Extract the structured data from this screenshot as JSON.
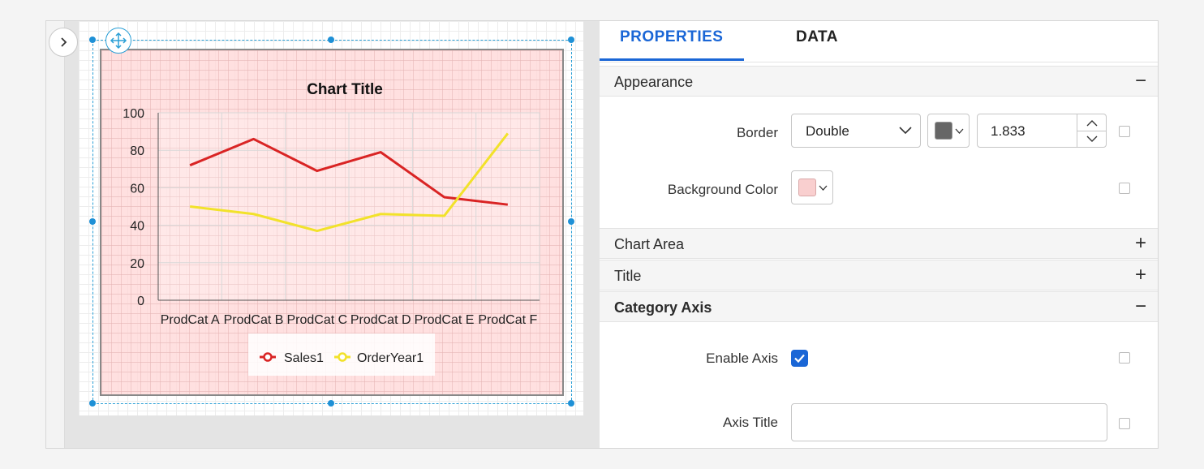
{
  "panel": {
    "tabs": [
      {
        "label": "PROPERTIES",
        "active": true
      },
      {
        "label": "DATA",
        "active": false
      }
    ],
    "sections": {
      "appearance": {
        "title": "Appearance",
        "expanded": true,
        "sign": "−"
      },
      "chart_area": {
        "title": "Chart Area",
        "expanded": false,
        "sign": "+"
      },
      "title": {
        "title": "Title",
        "expanded": false,
        "sign": "+"
      },
      "category_axis": {
        "title": "Category Axis",
        "expanded": true,
        "sign": "−"
      }
    },
    "border": {
      "label": "Border",
      "style_value": "Double",
      "color": "#666666",
      "width_value": "1.833"
    },
    "background_color": {
      "label": "Background Color",
      "color": "#f9cfcf"
    },
    "enable_axis": {
      "label": "Enable Axis",
      "checked": true
    },
    "axis_title": {
      "label": "Axis Title",
      "value": ""
    }
  },
  "colors": {
    "accent": "#1a66d6",
    "selection": "#1e90d6"
  },
  "icons": {
    "toggle": "chevron-right-icon",
    "move": "move-arrows-icon",
    "dropdown": "chevron-down-icon",
    "spin_up": "chevron-up-icon",
    "spin_down": "chevron-down-icon"
  },
  "chart_data": {
    "type": "line",
    "title": "Chart Title",
    "categories": [
      "ProdCat A",
      "ProdCat B",
      "ProdCat C",
      "ProdCat D",
      "ProdCat E",
      "ProdCat F"
    ],
    "series": [
      {
        "name": "Sales1",
        "color": "#d92424",
        "values": [
          72,
          86,
          69,
          79,
          55,
          51
        ]
      },
      {
        "name": "OrderYear1",
        "color": "#f2e22a",
        "values": [
          50,
          46,
          37,
          46,
          45,
          89
        ]
      }
    ],
    "yticks": [
      "0",
      "20",
      "40",
      "60",
      "80",
      "100"
    ],
    "ylim": [
      0,
      100
    ],
    "grid": true,
    "legend": "bottom"
  }
}
